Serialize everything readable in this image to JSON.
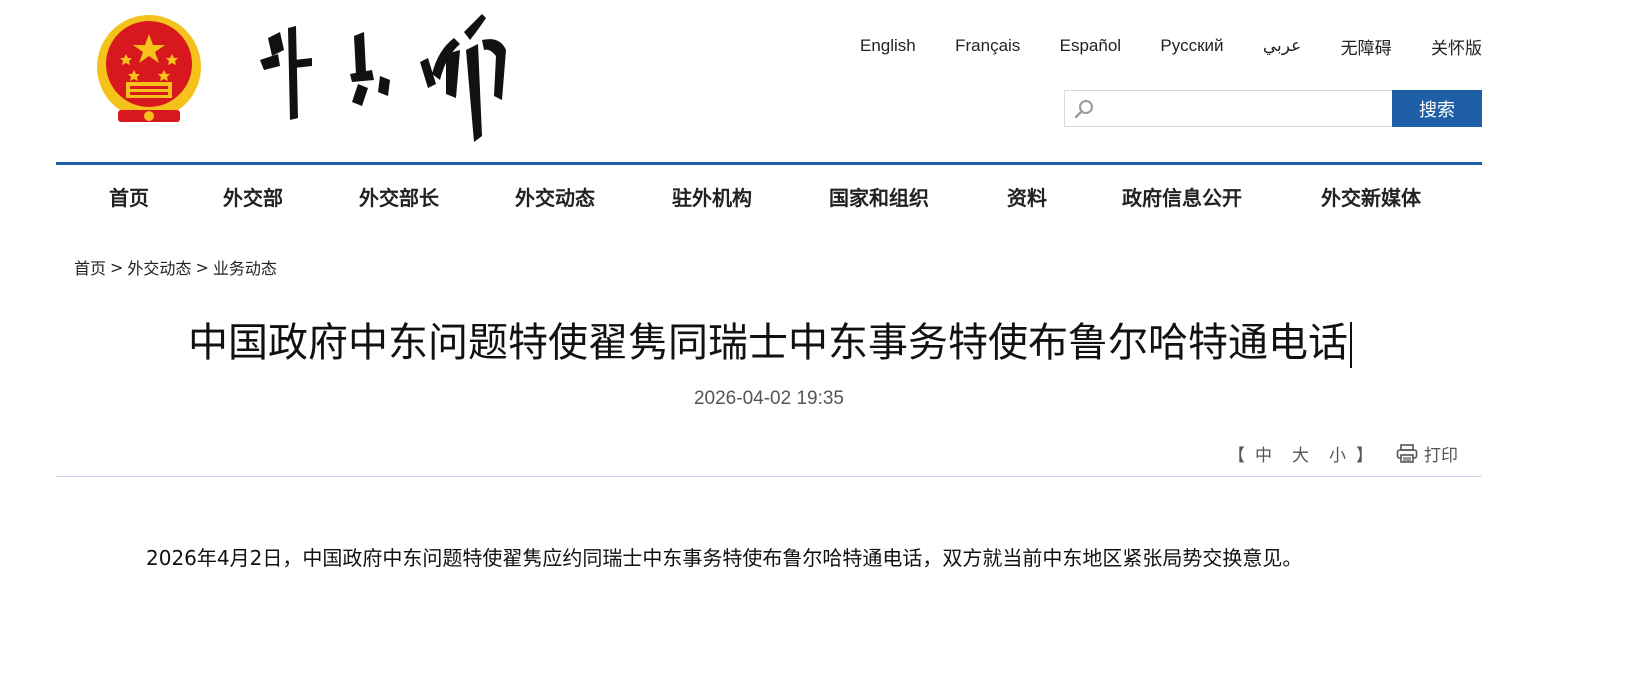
{
  "header": {
    "emblem_icon": "national-emblem-icon",
    "logo_icon": "calligraphy-logo-icon",
    "languages": [
      "English",
      "Français",
      "Español",
      "Русский",
      "عربي",
      "无障碍",
      "关怀版"
    ],
    "search": {
      "placeholder": "",
      "value": "",
      "button_label": "搜索",
      "icon": "search-icon"
    }
  },
  "nav": {
    "items": [
      "首页",
      "外交部",
      "外交部长",
      "外交动态",
      "驻外机构",
      "国家和组织",
      "资料",
      "政府信息公开",
      "外交新媒体"
    ]
  },
  "breadcrumb": {
    "items": [
      "首页",
      "外交动态",
      "业务动态"
    ],
    "separator": ">"
  },
  "article": {
    "title": "中国政府中东问题特使翟隽同瑞士中东事务特使布鲁尔哈特通电话",
    "date": "2026-04-02 19:35",
    "font_size": {
      "open": "【",
      "medium": "中",
      "large": "大",
      "small": "小",
      "close": "】"
    },
    "print_label": "打印",
    "print_icon": "printer-icon",
    "body": "2026年4月2日，中国政府中东问题特使翟隽应约同瑞士中东事务特使布鲁尔哈特通电话，双方就当前中东地区紧张局势交换意见。"
  },
  "colors": {
    "accent": "#1e5fa8",
    "emblem_red": "#d7191f",
    "emblem_gold": "#f4c21a"
  }
}
